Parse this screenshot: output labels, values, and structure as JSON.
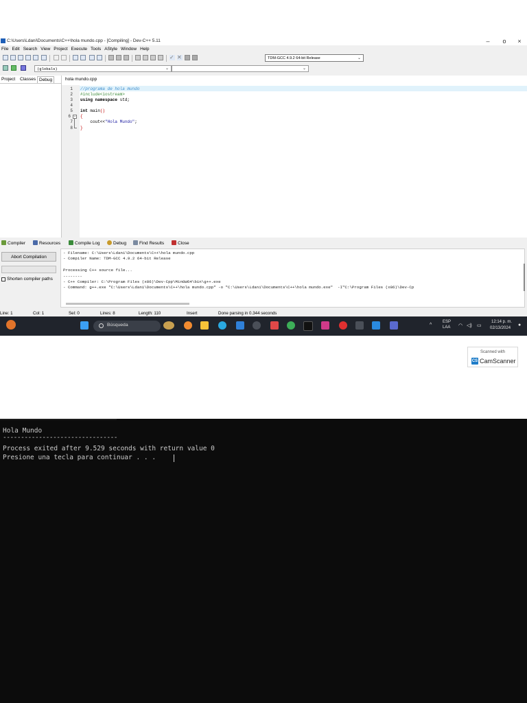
{
  "window": {
    "title": "C:\\Users\\Ldani\\Documents\\C++\\hola mundo.cpp - [Compiling] - Dev-C++ 5.11",
    "controls": [
      "–",
      "o",
      "×"
    ]
  },
  "menu": [
    "File",
    "Edit",
    "Search",
    "View",
    "Project",
    "Execute",
    "Tools",
    "AStyle",
    "Window",
    "Help"
  ],
  "toolbar": {
    "compiler_select": "TDM-GCC 4.9.2 64-bit Release",
    "scope_select": "(globals)"
  },
  "side_tabs": [
    "Project",
    "Classes",
    "Debug"
  ],
  "editor": {
    "file_tab": "hola mundo.cpp",
    "line_numbers": [
      "1",
      "2",
      "3",
      "4",
      "5",
      "6",
      "7",
      "8"
    ],
    "lines": {
      "l1": "//programa de hola mundo",
      "l2": "#include<iostream>",
      "l3_kw": "using namespace",
      "l3_rest": " std;",
      "l5_kw": "int",
      "l5_rest": " main",
      "l5_sym": "()",
      "l6": "{",
      "l7_pre": "    cout<<",
      "l7_str": "\"Hola Mundo\"",
      "l7_end": ";",
      "l8": "}"
    }
  },
  "bottom_tabs": [
    "Compiler",
    "Resources",
    "Compile Log",
    "Debug",
    "Find Results",
    "Close"
  ],
  "compile_panel": {
    "abort_button": "Abort Compilation",
    "shorten_label": "Shorten compiler paths",
    "log": [
      "- Filename: C:\\Users\\Ldani\\Documents\\C++\\hola mundo.cpp",
      "- Compiler Name: TDM-GCC 4.9.2 64-bit Release",
      "",
      "Processing C++ source file...",
      "--------",
      "- C++ Compiler: C:\\Program Files (x86)\\Dev-Cpp\\MinGW64\\bin\\g++.exe",
      "- Command: g++.exe \"C:\\Users\\Ldani\\Documents\\C++\\hola mundo.cpp\" -o \"C:\\Users\\Ldani\\Documents\\C++\\hola mundo.exe\"  -I\"C:\\Program Files (x86)\\Dev-Cp"
    ]
  },
  "status": {
    "line": "Line:   1",
    "col": "Col:   1",
    "sel": "Sel:   0",
    "lines": "Lines:   8",
    "length": "Length:  110",
    "mode": "Insert",
    "message": "Done parsing in 0.344 seconds"
  },
  "taskbar": {
    "search": "Búsqueda",
    "lang1": "ESP",
    "lang2": "LAA",
    "time": "12:14 p. m.",
    "date": "02/13/2024"
  },
  "scanner": {
    "scanned_with": "Scanned with",
    "brand": "CamScanner"
  },
  "console": {
    "lines": [
      "Hola Mundo",
      "--------------------------------",
      "Process exited after 9.529 seconds with return value 0",
      "Presione una tecla para continuar . . ."
    ]
  },
  "colors": {
    "taskbar": "#20242c",
    "console_bg": "#0c0c0c",
    "console_text": "#cccccc",
    "current_line": "#e0f2fb"
  }
}
